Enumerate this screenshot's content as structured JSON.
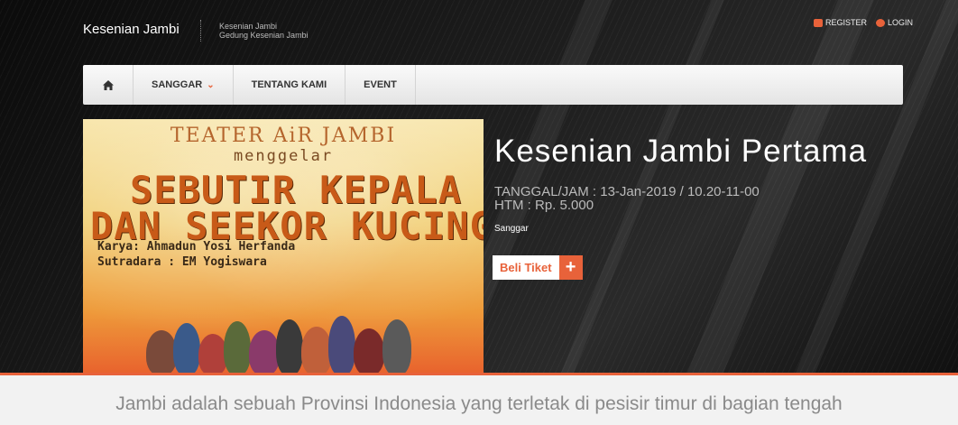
{
  "header": {
    "brand": "Kesenian Jambi",
    "brand_sub_1": "Kesenian Jambi",
    "brand_sub_2": "Gedung Kesenian Jambi",
    "register": "REGISTER",
    "login": "LOGIN"
  },
  "nav": {
    "home_icon": "home-icon",
    "items": [
      "SANGGAR",
      "TENTANG KAMI",
      "EVENT"
    ]
  },
  "poster": {
    "line1": "TEATER AiR JAMBI",
    "line2": "menggelar",
    "line3": "SEBUTIR KEPALA",
    "line4": "DAN SEEKOR KUCING",
    "line5": "Karya: Ahmadun Yosi Herfanda",
    "line6": "Sutradara : EM Yogiswara"
  },
  "event": {
    "title": "Kesenian Jambi Pertama",
    "datetime": "TANGGAL/JAM : 13-Jan-2019 / 10.20-11-00",
    "htm": "HTM : Rp. 5.000",
    "category": "Sanggar",
    "buy_label": "Beli Tiket",
    "buy_plus": "+"
  },
  "intro": {
    "text": "Jambi adalah sebuah Provinsi Indonesia yang terletak di pesisir timur di bagian tengah"
  },
  "colors": {
    "accent": "#e8623a",
    "hero_bg": "#141414",
    "navbar_bg": "#f0f0f0"
  }
}
